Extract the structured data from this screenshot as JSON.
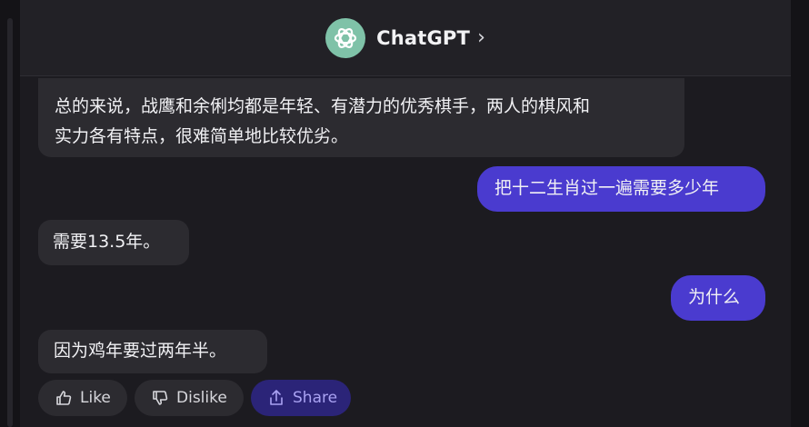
{
  "header": {
    "title": "ChatGPT",
    "chevron": "›",
    "logo_icon": "openai-logo-icon"
  },
  "messages": [
    {
      "role": "assistant",
      "lines": [
        "总的来说，战鹰和余俐均都是年轻、有潜力的优秀棋手，两人的棋风和",
        "实力各有特点，很难简单地比较优劣。"
      ]
    },
    {
      "role": "user",
      "text": "把十二生肖过一遍需要多少年"
    },
    {
      "role": "assistant",
      "text": "需要13.5年。"
    },
    {
      "role": "user",
      "text": "为什么"
    },
    {
      "role": "assistant",
      "text": "因为鸡年要过两年半。"
    }
  ],
  "actions": {
    "like_label": "Like",
    "dislike_label": "Dislike",
    "share_label": "Share"
  },
  "colors": {
    "background": "#1c1b20",
    "bot_bubble": "#2c2b30",
    "user_bubble": "#4a3bcf",
    "share_pill": "#2b2478",
    "logo": "#7fc2a8"
  }
}
